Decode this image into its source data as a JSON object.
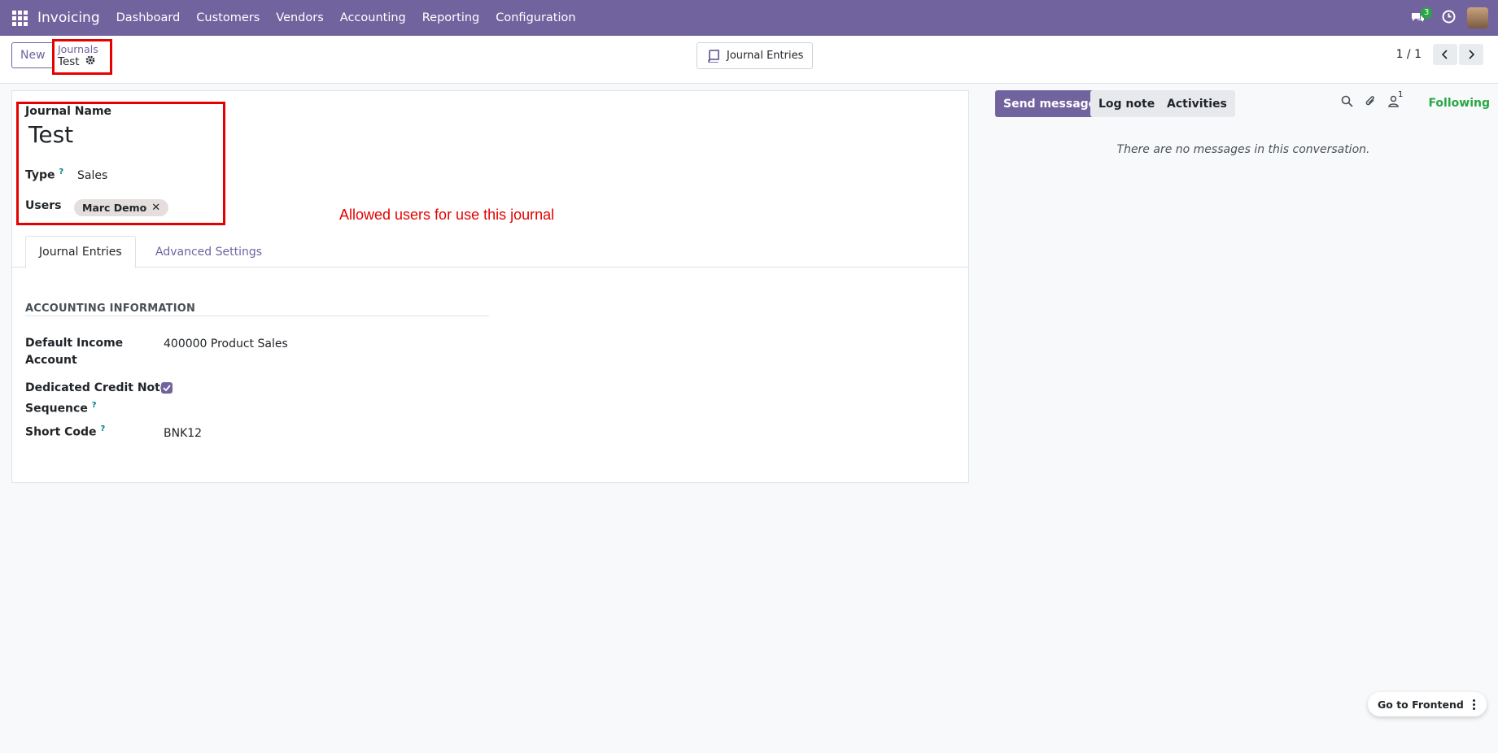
{
  "navbar": {
    "app_name": "Invoicing",
    "menu": [
      "Dashboard",
      "Customers",
      "Vendors",
      "Accounting",
      "Reporting",
      "Configuration"
    ],
    "chat_count": "3",
    "accent": "#71639e"
  },
  "control_panel": {
    "new_label": "New",
    "breadcrumb_parent": "Journals",
    "breadcrumb_current": "Test",
    "smart_button": "Journal Entries",
    "pager": "1 / 1"
  },
  "form": {
    "journal_name_label": "Journal Name",
    "journal_name": "Test",
    "type_label": "Type",
    "type_help": "?",
    "type_value": "Sales",
    "users_label": "Users",
    "users_tag": "Marc Demo",
    "annotation": "Allowed users for use this journal",
    "tabs": [
      "Journal Entries",
      "Advanced Settings"
    ],
    "section_title": "ACCOUNTING INFORMATION",
    "income_label_1": "Default Income",
    "income_label_2": "Account",
    "income_value": "400000 Product Sales",
    "credit_label_1": "Dedicated Credit Note",
    "credit_label_2": "Sequence",
    "credit_help": "?",
    "short_code_label": "Short Code",
    "short_code_help": "?",
    "short_code_value": "BNK12"
  },
  "chatter": {
    "send_message": "Send message",
    "log_note": "Log note",
    "activities": "Activities",
    "follower_count": "1",
    "following": "Following",
    "empty": "There are no messages in this conversation."
  },
  "floating": {
    "frontend_label": "Go to Frontend"
  }
}
